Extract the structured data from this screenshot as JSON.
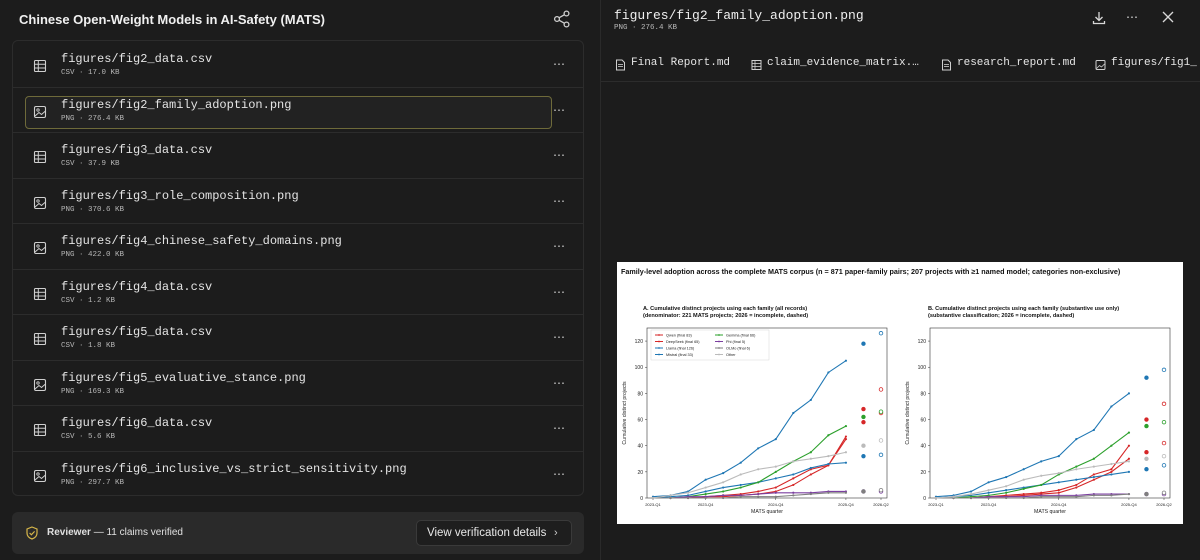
{
  "left": {
    "title": "Chinese Open-Weight Models in AI-Safety (MATS)",
    "files": [
      {
        "name": "figures/fig2_data.csv",
        "meta": "CSV · 17.0 KB",
        "icon": "table-icon"
      },
      {
        "name": "figures/fig2_family_adoption.png",
        "meta": "PNG · 276.4 KB",
        "icon": "image-icon",
        "selected": true
      },
      {
        "name": "figures/fig3_data.csv",
        "meta": "CSV · 37.9 KB",
        "icon": "table-icon"
      },
      {
        "name": "figures/fig3_role_composition.png",
        "meta": "PNG · 370.6 KB",
        "icon": "image-icon"
      },
      {
        "name": "figures/fig4_chinese_safety_domains.png",
        "meta": "PNG · 422.0 KB",
        "icon": "image-icon"
      },
      {
        "name": "figures/fig4_data.csv",
        "meta": "CSV · 1.2 KB",
        "icon": "table-icon"
      },
      {
        "name": "figures/fig5_data.csv",
        "meta": "CSV · 1.8 KB",
        "icon": "table-icon"
      },
      {
        "name": "figures/fig5_evaluative_stance.png",
        "meta": "PNG · 169.3 KB",
        "icon": "image-icon"
      },
      {
        "name": "figures/fig6_data.csv",
        "meta": "CSV · 5.6 KB",
        "icon": "table-icon"
      },
      {
        "name": "figures/fig6_inclusive_vs_strict_sensitivity.png",
        "meta": "PNG · 297.7 KB",
        "icon": "image-icon"
      }
    ],
    "menu_glyph": "⋯",
    "reviewer": {
      "label": "Reviewer",
      "text": " — 11 claims verified"
    },
    "verify_button": "View verification details",
    "verify_chevron": "›"
  },
  "right": {
    "title": "figures/fig2_family_adoption.png",
    "meta": "PNG · 276.4 KB",
    "more": "⋯",
    "tabs": [
      {
        "label": "Final Report.md",
        "icon": "document-icon"
      },
      {
        "label": "claim_evidence_matrix.…",
        "icon": "table-icon"
      },
      {
        "label": "research_report.md",
        "icon": "document-icon"
      },
      {
        "label": "figures/fig1_",
        "icon": "image-icon"
      }
    ]
  },
  "figure": {
    "title": "Family-level adoption across the complete MATS corpus (n = 871 paper-family pairs; 207 projects with ≥1 named model; categories non-exclusive)",
    "panelA_title": "A. Cumulative distinct projects using each family (all records)",
    "panelA_subtitle": "(denominator: 221 MATS projects; 2026 = incomplete, dashed)",
    "panelB_title": "B. Cumulative distinct projects using each family (substantive use only)",
    "panelB_subtitle": "(substantive classification; 2026 = incomplete, dashed)"
  },
  "chart_data": [
    {
      "type": "line",
      "title": "A. Cumulative distinct projects using each family (all records)",
      "subtitle": "(denominator: 221 MATS projects; 2026 = incomplete, dashed)",
      "xlabel": "MATS quarter",
      "ylabel": "Cumulative distinct projects",
      "x": [
        "2023-Q1",
        "2023-Q2",
        "2023-Q3",
        "2023-Q4",
        "2024-Q1",
        "2024-Q2",
        "2024-Q3",
        "2024-Q4",
        "2025-Q1",
        "2025-Q2",
        "2025-Q3",
        "2025-Q4",
        "2026-Q1",
        "2026-Q2"
      ],
      "xticks": [
        "2023-Q1",
        "2023-Q4",
        "2024-Q4",
        "2025-Q4",
        "2026-Q2"
      ],
      "ylim": [
        0,
        130
      ],
      "yticks": [
        0,
        20,
        40,
        60,
        80,
        100,
        120
      ],
      "legend_position": "top-left",
      "series": [
        {
          "name": "Qwen (final 83)",
          "color": "#d62728",
          "values": [
            0,
            0,
            0,
            1,
            2,
            3,
            5,
            8,
            15,
            22,
            25,
            45,
            68,
            83
          ]
        },
        {
          "name": "DeepSeek (final 65)",
          "color": "#d62728",
          "values": [
            0,
            0,
            0,
            1,
            1,
            2,
            3,
            5,
            10,
            18,
            25,
            47,
            58,
            65
          ]
        },
        {
          "name": "Llama (final 126)",
          "color": "#1f77b4",
          "values": [
            1,
            2,
            5,
            14,
            19,
            27,
            38,
            45,
            65,
            75,
            96,
            105,
            118,
            126
          ]
        },
        {
          "name": "Mistral (final 33)",
          "color": "#1f77b4",
          "values": [
            0,
            1,
            2,
            5,
            8,
            10,
            12,
            15,
            18,
            23,
            26,
            27,
            32,
            33
          ]
        },
        {
          "name": "Gemma (final 66)",
          "color": "#2ca02c",
          "values": [
            0,
            0,
            1,
            3,
            5,
            8,
            12,
            20,
            28,
            35,
            48,
            55,
            62,
            66
          ]
        },
        {
          "name": "Phi (final 5)",
          "color": "#7b3fa0",
          "values": [
            0,
            0,
            1,
            1,
            2,
            2,
            3,
            4,
            4,
            4,
            5,
            5,
            5,
            5
          ]
        },
        {
          "name": "OLMo (final 6)",
          "color": "#7f7f7f",
          "values": [
            0,
            0,
            0,
            0,
            0,
            1,
            1,
            1,
            2,
            3,
            4,
            4,
            5,
            6
          ]
        },
        {
          "name": "Other",
          "color": "#bbbbbb",
          "values": [
            0,
            2,
            4,
            8,
            12,
            18,
            22,
            24,
            28,
            30,
            32,
            35,
            40,
            44
          ]
        }
      ]
    },
    {
      "type": "line",
      "title": "B. Cumulative distinct projects using each family (substantive use only)",
      "subtitle": "(substantive classification; 2026 = incomplete, dashed)",
      "xlabel": "MATS quarter",
      "ylabel": "Cumulative distinct projects",
      "x": [
        "2023-Q1",
        "2023-Q2",
        "2023-Q3",
        "2023-Q4",
        "2024-Q1",
        "2024-Q2",
        "2024-Q3",
        "2024-Q4",
        "2025-Q1",
        "2025-Q2",
        "2025-Q3",
        "2025-Q4",
        "2026-Q1",
        "2026-Q2"
      ],
      "xticks": [
        "2023-Q1",
        "2023-Q4",
        "2024-Q4",
        "2025-Q4",
        "2026-Q2"
      ],
      "ylim": [
        0,
        130
      ],
      "yticks": [
        0,
        20,
        40,
        60,
        80,
        100,
        120
      ],
      "series": [
        {
          "name": "Qwen",
          "color": "#d62728",
          "values": [
            0,
            0,
            0,
            1,
            2,
            3,
            4,
            6,
            10,
            18,
            22,
            40,
            60,
            72
          ]
        },
        {
          "name": "DeepSeek",
          "color": "#d62728",
          "values": [
            0,
            0,
            0,
            1,
            1,
            2,
            3,
            4,
            8,
            14,
            20,
            30,
            35,
            42
          ]
        },
        {
          "name": "Llama",
          "color": "#1f77b4",
          "values": [
            1,
            2,
            5,
            12,
            16,
            22,
            28,
            32,
            45,
            52,
            70,
            80,
            92,
            98
          ]
        },
        {
          "name": "Mistral",
          "color": "#1f77b4",
          "values": [
            0,
            1,
            2,
            4,
            6,
            8,
            10,
            12,
            14,
            16,
            18,
            20,
            22,
            25
          ]
        },
        {
          "name": "Gemma",
          "color": "#2ca02c",
          "values": [
            0,
            0,
            1,
            2,
            4,
            7,
            10,
            18,
            24,
            30,
            40,
            50,
            55,
            58
          ]
        },
        {
          "name": "Phi",
          "color": "#7b3fa0",
          "values": [
            0,
            0,
            0,
            1,
            1,
            1,
            2,
            2,
            2,
            3,
            3,
            3,
            3,
            3
          ]
        },
        {
          "name": "OLMo",
          "color": "#7f7f7f",
          "values": [
            0,
            0,
            0,
            0,
            0,
            0,
            1,
            1,
            1,
            2,
            2,
            3,
            3,
            4
          ]
        },
        {
          "name": "Other",
          "color": "#bbbbbb",
          "values": [
            0,
            1,
            3,
            6,
            9,
            14,
            17,
            19,
            22,
            24,
            26,
            28,
            30,
            32
          ]
        }
      ]
    }
  ]
}
